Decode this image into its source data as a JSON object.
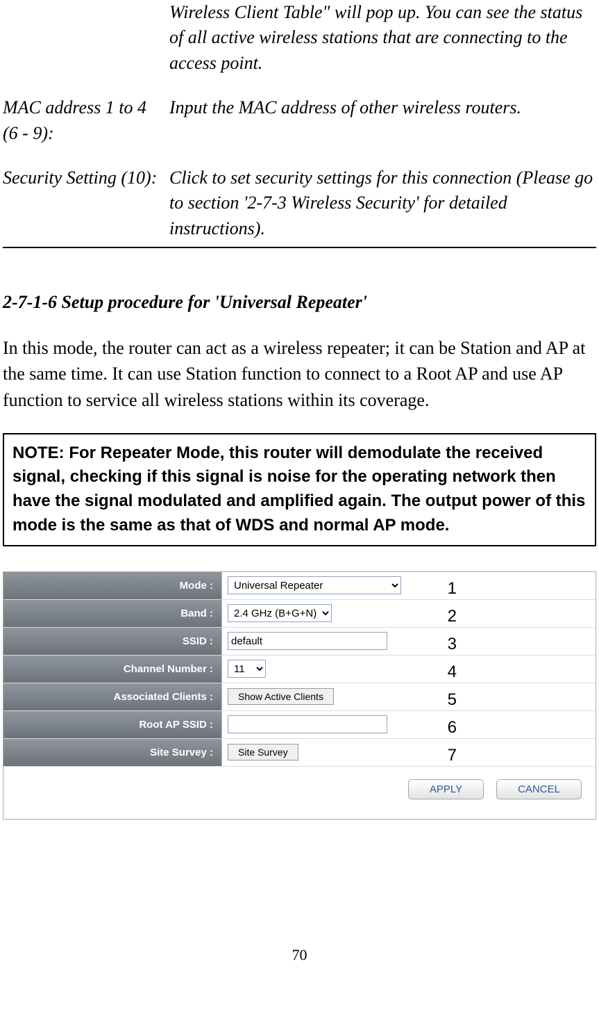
{
  "definitions": {
    "intro_tail": "Wireless Client Table\" will pop up. You can see the status of all active wireless stations that are connecting to the access point.",
    "mac": {
      "label": "MAC address 1 to 4 (6 - 9):",
      "desc": "Input the MAC address of other wireless routers."
    },
    "security": {
      "label": "Security Setting (10):",
      "desc": "Click to set security settings for this connection (Please go to section '2-7-3 Wireless Security' for detailed instructions)."
    }
  },
  "section_heading": "2-7-1-6 Setup procedure for 'Universal Repeater'",
  "body_para": "In this mode, the router can act as a wireless repeater; it can be Station and AP at the same time. It can use Station function to connect to a Root AP and use AP function to service all wireless stations within its coverage.",
  "note": "NOTE: For Repeater Mode, this router will demodulate the received signal, checking if this signal is noise for the operating network then have the signal modulated and amplified again. The output power of this mode is the same as that of WDS and normal AP mode.",
  "panel": {
    "rows": {
      "mode": {
        "label": "Mode :",
        "value": "Universal Repeater",
        "num": "1"
      },
      "band": {
        "label": "Band :",
        "value": "2.4 GHz (B+G+N)",
        "num": "2"
      },
      "ssid": {
        "label": "SSID :",
        "value": "default",
        "num": "3"
      },
      "chan": {
        "label": "Channel Number :",
        "value": "11",
        "num": "4"
      },
      "assoc": {
        "label": "Associated Clients :",
        "button": "Show Active Clients",
        "num": "5"
      },
      "root": {
        "label": "Root AP SSID :",
        "value": "",
        "num": "6"
      },
      "survey": {
        "label": "Site Survey :",
        "button": "Site Survey",
        "num": "7"
      }
    },
    "apply": "APPLY",
    "cancel": "CANCEL"
  },
  "page_number": "70"
}
